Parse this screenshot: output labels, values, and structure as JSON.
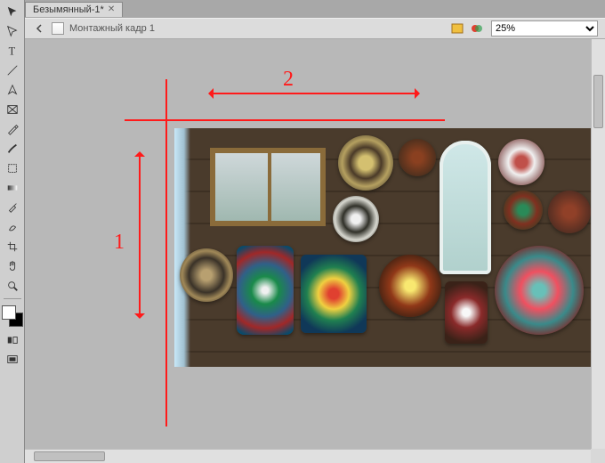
{
  "tab": {
    "title": "Безымянный-1*"
  },
  "header": {
    "breadcrumb": "Монтажный кадр 1",
    "zoom": "25%"
  },
  "colors": {
    "guide": "#ff1a1a"
  },
  "annotations": {
    "label_vertical": "1",
    "label_horizontal": "2"
  },
  "tools": [
    {
      "name": "selection-tool"
    },
    {
      "name": "direct-selection-tool"
    },
    {
      "name": "type-tool"
    },
    {
      "name": "line-tool"
    },
    {
      "name": "pen-tool"
    },
    {
      "name": "rectangle-frame-tool"
    },
    {
      "name": "pencil-tool"
    },
    {
      "name": "brush-tool"
    },
    {
      "name": "free-transform-tool"
    },
    {
      "name": "gradient-tool"
    },
    {
      "name": "eyedropper-tool"
    },
    {
      "name": "smudge-tool"
    },
    {
      "name": "crop-tool"
    },
    {
      "name": "hand-tool"
    },
    {
      "name": "zoom-tool"
    }
  ]
}
